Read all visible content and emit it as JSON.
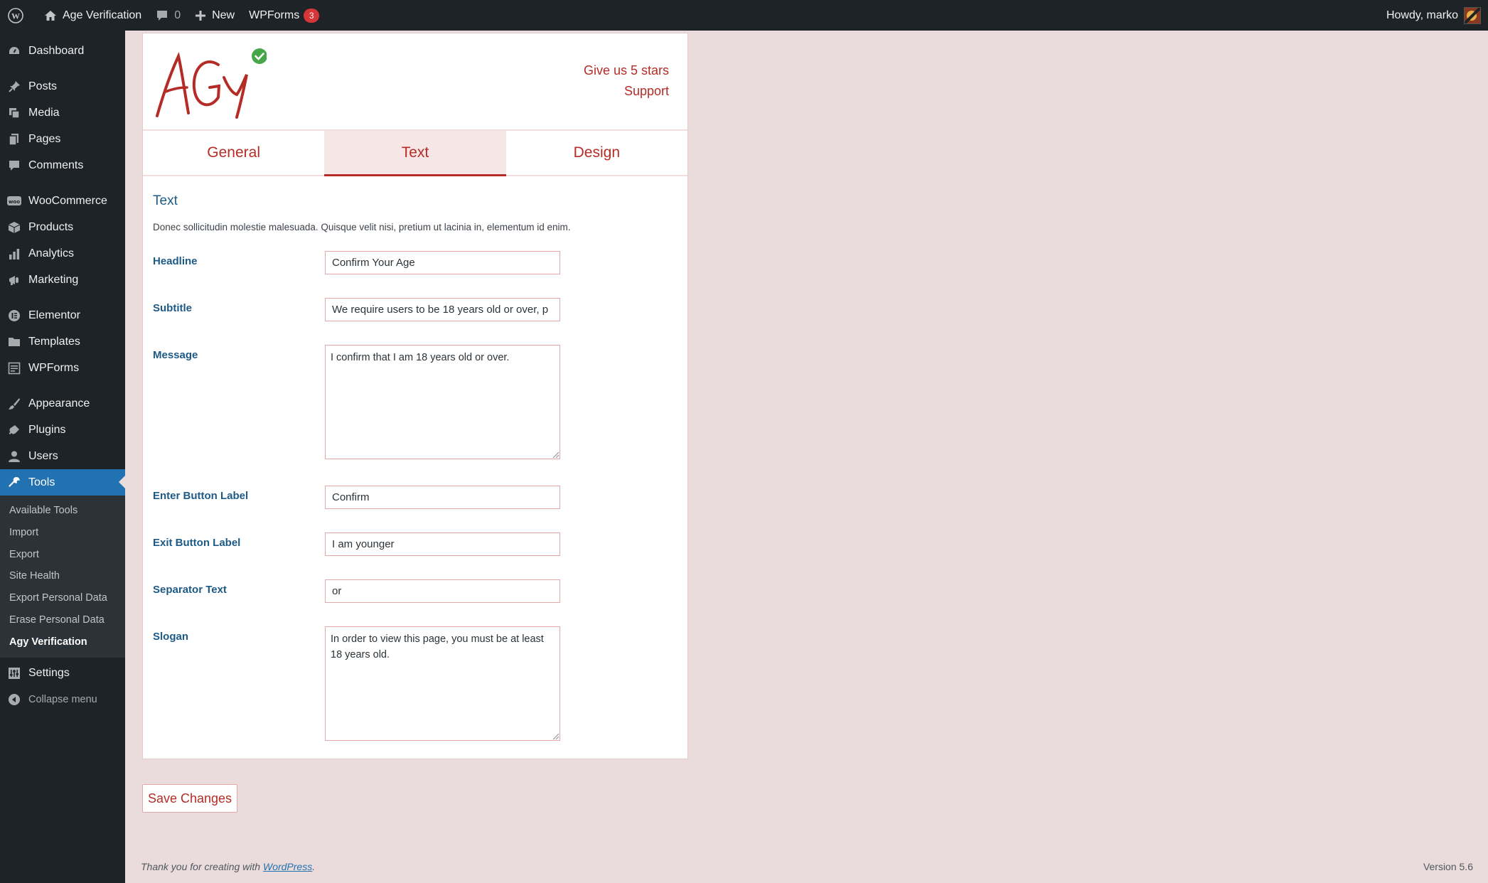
{
  "adminbar": {
    "site_name": "Age Verification",
    "comments_count": "0",
    "new_label": "New",
    "wpforms_label": "WPForms",
    "wpforms_count": "3",
    "howdy": "Howdy, marko"
  },
  "sidebar": {
    "items": [
      {
        "label": "Dashboard",
        "icon": "dashboard-icon"
      },
      {
        "label": "Posts",
        "icon": "pin-icon"
      },
      {
        "label": "Media",
        "icon": "media-icon"
      },
      {
        "label": "Pages",
        "icon": "pages-icon"
      },
      {
        "label": "Comments",
        "icon": "comment-icon"
      },
      {
        "label": "WooCommerce",
        "icon": "woocommerce-icon"
      },
      {
        "label": "Products",
        "icon": "box-icon"
      },
      {
        "label": "Analytics",
        "icon": "bar-chart-icon"
      },
      {
        "label": "Marketing",
        "icon": "megaphone-icon"
      },
      {
        "label": "Elementor",
        "icon": "elementor-icon"
      },
      {
        "label": "Templates",
        "icon": "folder-icon"
      },
      {
        "label": "WPForms",
        "icon": "form-icon"
      },
      {
        "label": "Appearance",
        "icon": "brush-icon"
      },
      {
        "label": "Plugins",
        "icon": "plug-icon"
      },
      {
        "label": "Users",
        "icon": "user-icon"
      },
      {
        "label": "Tools",
        "icon": "wrench-icon"
      },
      {
        "label": "Settings",
        "icon": "settings-icon"
      }
    ],
    "tools_submenu": [
      "Available Tools",
      "Import",
      "Export",
      "Site Health",
      "Export Personal Data",
      "Erase Personal Data",
      "Agy Verification"
    ],
    "collapse_label": "Collapse menu"
  },
  "header": {
    "logo_text": "AGY",
    "rate_link": "Give us 5 stars",
    "support_link": "Support"
  },
  "tabs": [
    "General",
    "Text",
    "Design"
  ],
  "active_tab": "Text",
  "section": {
    "title": "Text",
    "description": "Donec sollicitudin molestie malesuada. Quisque velit nisi, pretium ut lacinia in, elementum id enim."
  },
  "fields": {
    "headline": {
      "label": "Headline",
      "value": "Confirm Your Age"
    },
    "subtitle": {
      "label": "Subtitle",
      "value": "We require users to be 18 years old or over, p"
    },
    "message": {
      "label": "Message",
      "value": "I confirm that I am 18 years old or over."
    },
    "enter_button": {
      "label": "Enter Button Label",
      "value": "Confirm"
    },
    "exit_button": {
      "label": "Exit Button Label",
      "value": "I am younger"
    },
    "separator": {
      "label": "Separator Text",
      "value": "or"
    },
    "slogan": {
      "label": "Slogan",
      "value": "In order to view this page, you must be at least 18 years old."
    }
  },
  "save_label": "Save Changes",
  "footer": {
    "thanks_prefix": "Thank you for creating with ",
    "thanks_link": "WordPress",
    "thanks_suffix": ".",
    "version": "Version 5.6"
  },
  "colors": {
    "accent": "#b52c26",
    "label_blue": "#1e5a86",
    "admin_dark": "#1d2327",
    "admin_blue": "#2271b1",
    "page_bg": "#eadcdc",
    "badge_green": "#46a74a"
  }
}
